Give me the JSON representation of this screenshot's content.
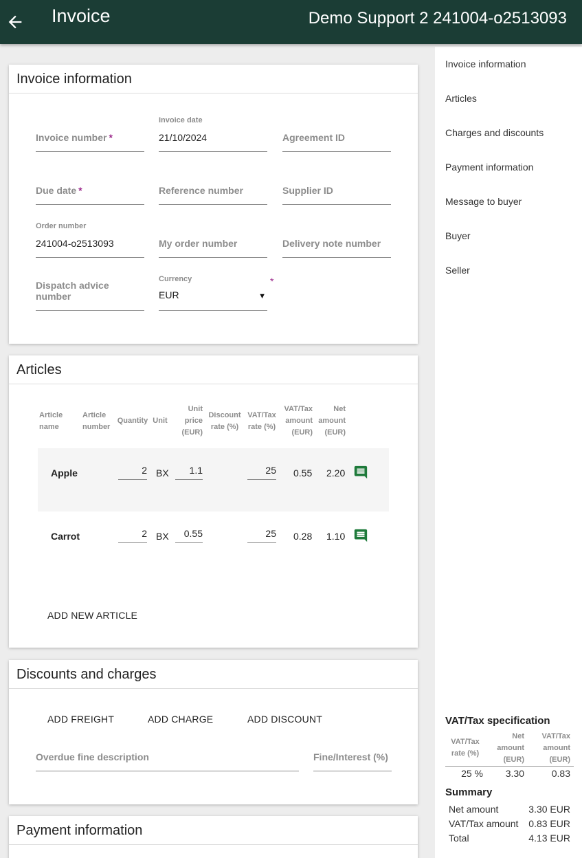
{
  "header": {
    "title": "Invoice",
    "right_text": "Demo Support 2 241004-o2513093"
  },
  "invoice_info": {
    "title": "Invoice information",
    "fields": {
      "invoice_number": {
        "label": "Invoice number",
        "required": "*"
      },
      "invoice_date": {
        "label": "Invoice date",
        "value": "21/10/2024"
      },
      "agreement_id": {
        "label": "Agreement ID"
      },
      "due_date": {
        "label": "Due date",
        "required": "*"
      },
      "reference_number": {
        "label": "Reference number"
      },
      "supplier_id": {
        "label": "Supplier ID"
      },
      "order_number": {
        "label": "Order number",
        "value": "241004-o2513093"
      },
      "my_order_number": {
        "label": "My order number"
      },
      "delivery_note_number": {
        "label": "Delivery note number"
      },
      "dispatch_advice_number": {
        "label": "Dispatch advice number"
      },
      "currency": {
        "label": "Currency",
        "value": "EUR",
        "required": "*"
      }
    }
  },
  "articles": {
    "title": "Articles",
    "headers": {
      "name": [
        "Article",
        "name"
      ],
      "number": [
        "Article",
        "number"
      ],
      "quantity": [
        "Quantity"
      ],
      "unit": [
        "Unit"
      ],
      "unit_price": [
        "Unit",
        "price",
        "(EUR)"
      ],
      "discount": [
        "Discount",
        "rate (%)"
      ],
      "vat_rate": [
        "VAT/Tax",
        "rate (%)"
      ],
      "vat_amount": [
        "VAT/Tax",
        "amount",
        "(EUR)"
      ],
      "net_amount": [
        "Net",
        "amount",
        "(EUR)"
      ]
    },
    "rows": [
      {
        "name": "Apple",
        "quantity": "2",
        "unit": "BX",
        "unit_price": "1.1",
        "vat_rate": "25",
        "vat_amount": "0.55",
        "net_amount": "2.20"
      },
      {
        "name": "Carrot",
        "quantity": "2",
        "unit": "BX",
        "unit_price": "0.55",
        "vat_rate": "25",
        "vat_amount": "0.28",
        "net_amount": "1.10"
      }
    ],
    "add_button": "ADD NEW ARTICLE"
  },
  "discounts": {
    "title": "Discounts and charges",
    "add_freight": "ADD FREIGHT",
    "add_charge": "ADD CHARGE",
    "add_discount": "ADD DISCOUNT",
    "overdue_fine_label": "Overdue fine description",
    "fine_interest_label": "Fine/Interest (%)"
  },
  "payment": {
    "title": "Payment information"
  },
  "sidebar": {
    "nav": [
      "Invoice information",
      "Articles",
      "Charges and discounts",
      "Payment information",
      "Message to buyer",
      "Buyer",
      "Seller"
    ],
    "vat_spec": {
      "title": "VAT/Tax specification",
      "headers": {
        "rate": [
          "VAT/Tax",
          "rate (%)"
        ],
        "net": [
          "Net",
          "amount",
          "(EUR)"
        ],
        "vat": [
          "VAT/Tax",
          "amount",
          "(EUR)"
        ]
      },
      "row": {
        "rate": "25 %",
        "net": "3.30",
        "vat": "0.83"
      }
    },
    "summary": {
      "title": "Summary",
      "net_label": "Net amount",
      "net_value": "3.30 EUR",
      "vat_label": "VAT/Tax amount",
      "vat_value": "0.83 EUR",
      "total_label": "Total",
      "total_value": "4.13 EUR"
    }
  },
  "colors": {
    "header_bg": "#1b3d35",
    "required": "#9c2a8c",
    "comment_icon": "#1e7a3a"
  },
  "icons": {
    "back": "arrow-left-icon",
    "comment": "comment-icon",
    "dropdown": "caret-down-icon"
  }
}
